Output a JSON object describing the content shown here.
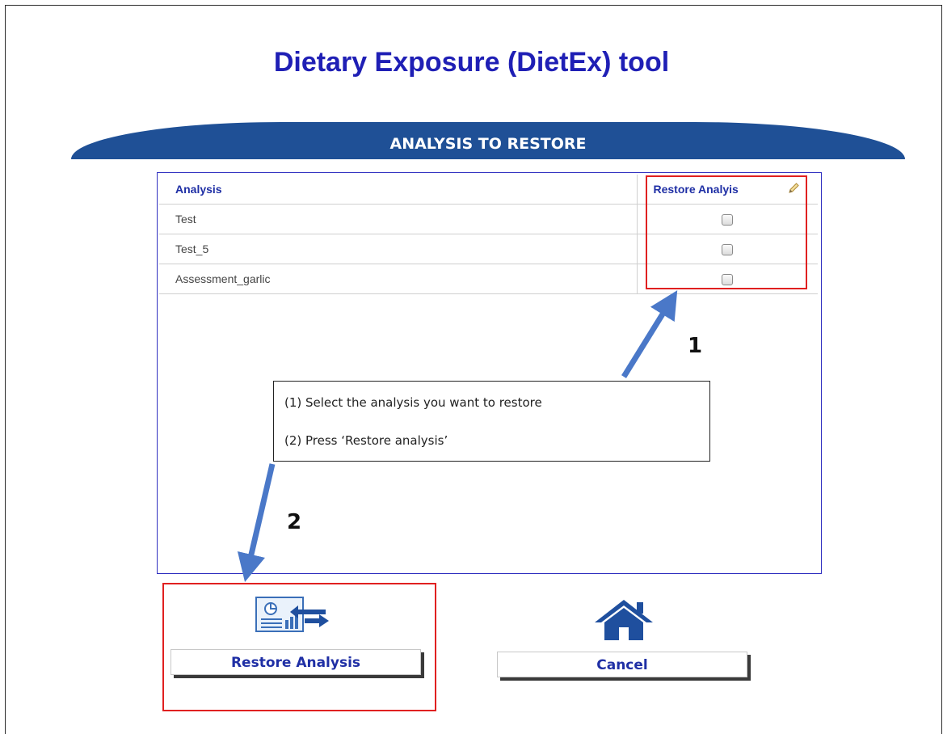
{
  "app": {
    "title": "Dietary Exposure (DietEx) tool"
  },
  "section": {
    "header": "ANALYSIS TO RESTORE"
  },
  "table": {
    "columns": {
      "analysis": "Analysis",
      "restore": "Restore Analyis",
      "edit_icon": "pencil-icon"
    },
    "rows": [
      {
        "name": "Test",
        "checked": false
      },
      {
        "name": "Test_5",
        "checked": false
      },
      {
        "name": "Assessment_garlic",
        "checked": false
      }
    ]
  },
  "callout": {
    "line1": "(1) Select the analysis you want to restore",
    "line2": "(2) Press ‘Restore analysis’"
  },
  "steps": {
    "one": "1",
    "two": "2"
  },
  "buttons": {
    "restore_label": "Restore Analysis",
    "restore_icon": "restore-analysis-icon",
    "cancel_label": "Cancel",
    "cancel_icon": "home-icon"
  },
  "colors": {
    "title": "#1f1fb5",
    "header_band": "#1f5096",
    "highlight": "#e02020",
    "arrow": "#4a78c8"
  }
}
